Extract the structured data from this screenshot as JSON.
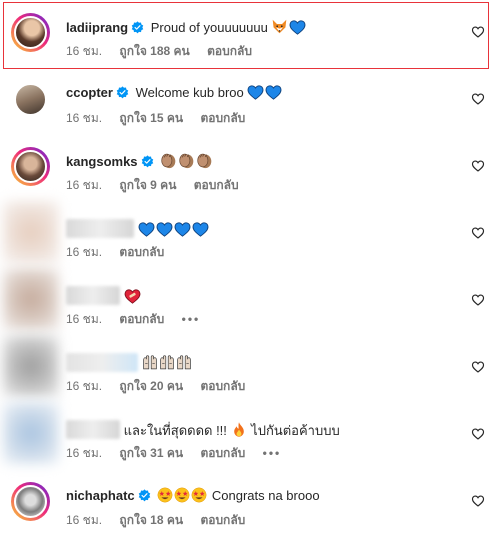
{
  "comments": [
    {
      "username": "ladiiprang",
      "verified": true,
      "text": "Proud of youuuuuuu",
      "emojis": [
        "fox",
        "blue-heart"
      ],
      "time": "16 ชม.",
      "likes": "ถูกใจ 188 คน",
      "reply": "ตอบกลับ",
      "more": ""
    },
    {
      "username": "ccopter",
      "verified": true,
      "text": "Welcome kub broo",
      "emojis": [
        "blue-heart",
        "blue-heart"
      ],
      "time": "16 ชม.",
      "likes": "ถูกใจ 15 คน",
      "reply": "ตอบกลับ",
      "more": ""
    },
    {
      "username": "kangsomks",
      "verified": true,
      "text": "",
      "emojis": [
        "clap",
        "clap",
        "clap"
      ],
      "time": "16 ชม.",
      "likes": "ถูกใจ 9 คน",
      "reply": "ตอบกลับ",
      "more": ""
    },
    {
      "username": "",
      "verified": false,
      "text": "",
      "emojis": [
        "blue-heart",
        "blue-heart",
        "blue-heart",
        "blue-heart"
      ],
      "time": "16 ชม.",
      "likes": "",
      "reply": "ตอบกลับ",
      "more": ""
    },
    {
      "username": "",
      "verified": false,
      "text": "",
      "emojis": [
        "mending-heart"
      ],
      "time": "16 ชม.",
      "likes": "",
      "reply": "ตอบกลับ",
      "more": "•••"
    },
    {
      "username": "",
      "verified": false,
      "text": "",
      "emojis": [
        "raising-hands",
        "raising-hands",
        "raising-hands"
      ],
      "time": "16 ชม.",
      "likes": "ถูกใจ 20 คน",
      "reply": "ตอบกลับ",
      "more": ""
    },
    {
      "username": "",
      "verified": false,
      "text": "และในที่สุดดดด !!!",
      "text2": "ไปกันต่อค้าบบบ",
      "emojis": [
        "fire"
      ],
      "time": "16 ชม.",
      "likes": "ถูกใจ 31 คน",
      "reply": "ตอบกลับ",
      "more": "•••"
    },
    {
      "username": "nichaphatc",
      "verified": true,
      "text": "Congrats na brooo",
      "emojis": [
        "star-struck",
        "star-struck",
        "star-struck"
      ],
      "time": "16 ชม.",
      "likes": "ถูกใจ 18 คน",
      "reply": "ตอบกลับ",
      "more": ""
    }
  ]
}
